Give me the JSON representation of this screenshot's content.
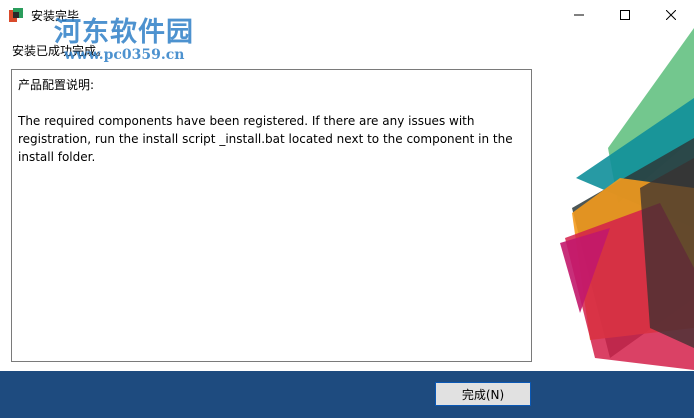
{
  "window": {
    "title": "安装完毕",
    "icon": "installer-icon"
  },
  "watermark": {
    "text": "河东软件园",
    "url": "www.pc0359.cn"
  },
  "status_text": "安装已成功完成。",
  "description": {
    "heading": "产品配置说明:",
    "body": "The required components have been registered. If there are any issues with registration, run the install script _install.bat located next to the component in the install folder."
  },
  "buttons": {
    "finish": "完成(N)"
  },
  "colors": {
    "footer": "#1e4b7f",
    "accent_green": "#5bbd7a",
    "accent_teal": "#0f8f9a",
    "accent_orange": "#f39a1d",
    "accent_red": "#d3204a",
    "accent_magenta": "#c2186b",
    "dark": "#3a3030"
  }
}
